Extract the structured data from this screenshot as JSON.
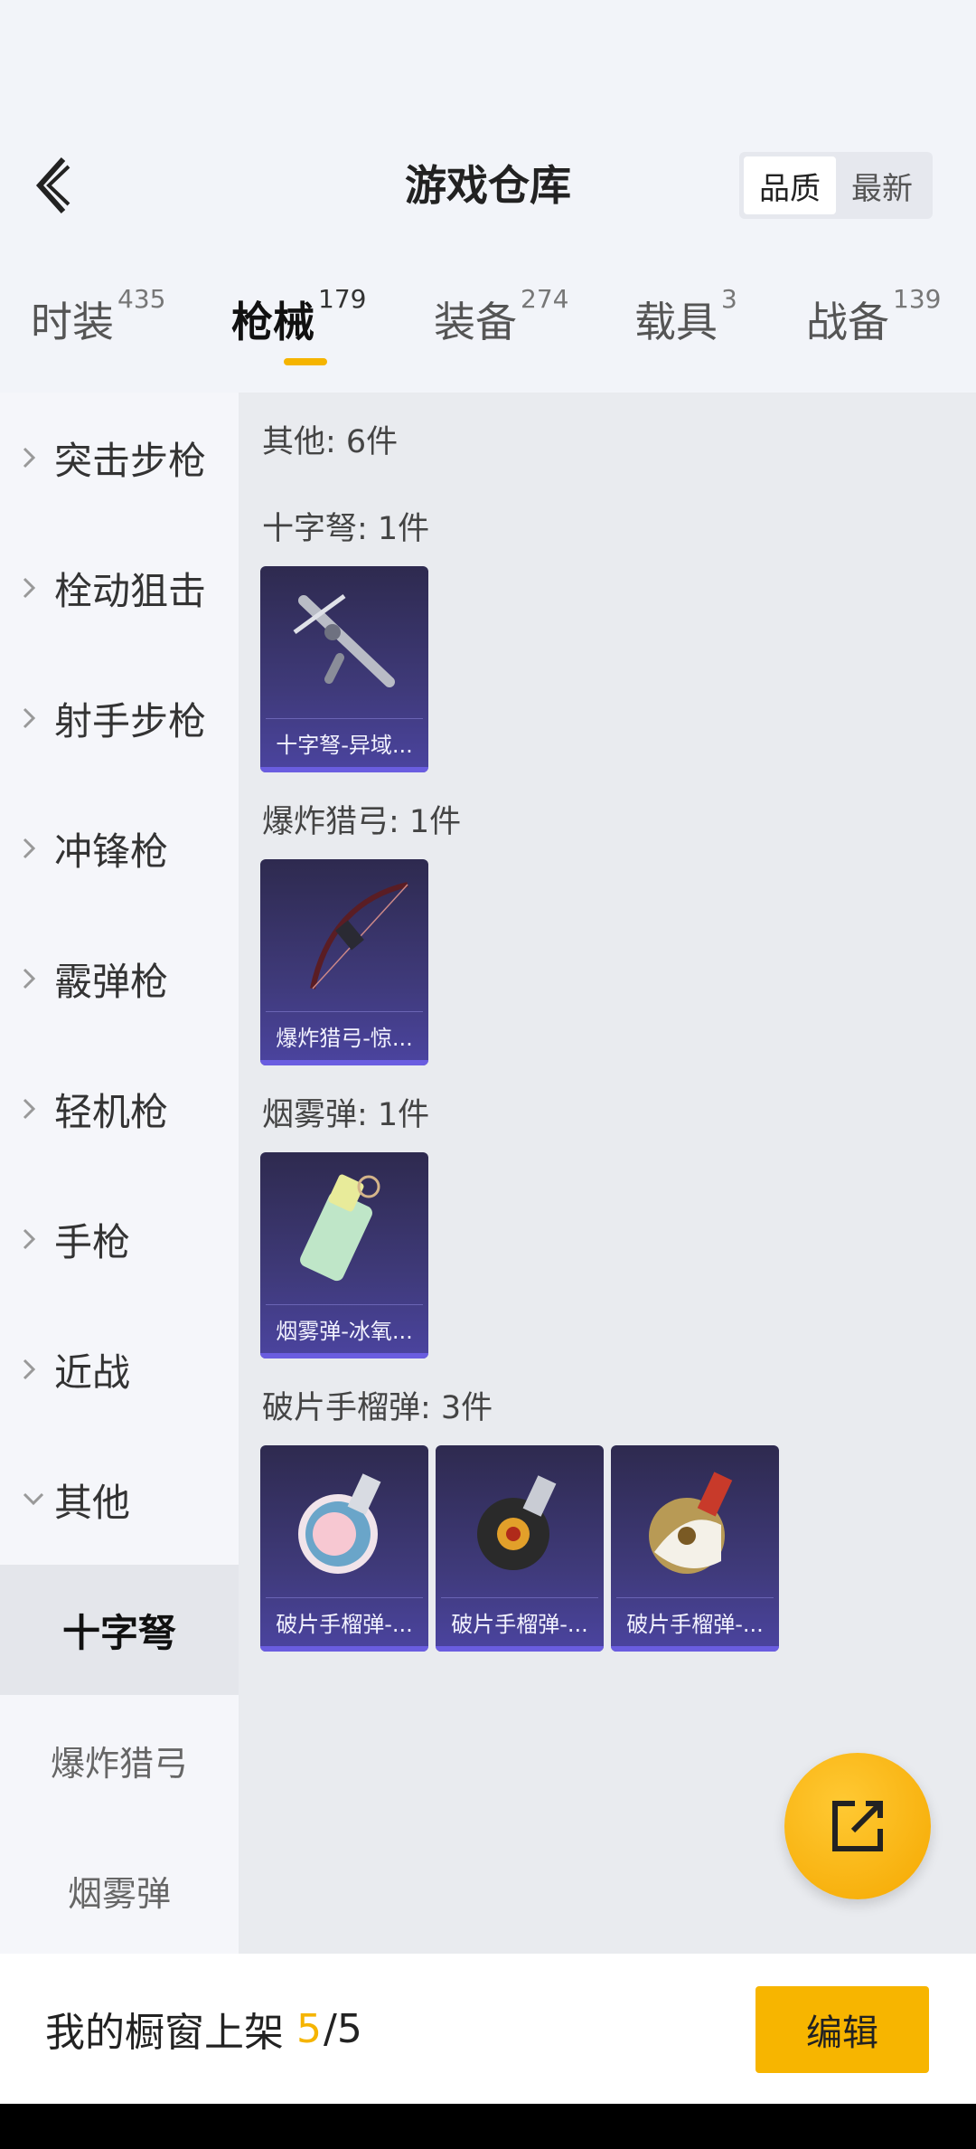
{
  "header": {
    "title": "游戏仓库",
    "sort_options": [
      "品质",
      "最新"
    ],
    "sort_selected": "品质"
  },
  "tabs": [
    {
      "label": "时装",
      "count": "435"
    },
    {
      "label": "枪械",
      "count": "179",
      "active": true
    },
    {
      "label": "装备",
      "count": "274"
    },
    {
      "label": "载具",
      "count": "3"
    },
    {
      "label": "战备",
      "count": "139"
    }
  ],
  "sidebar": {
    "categories": [
      "突击步枪",
      "栓动狙击",
      "射手步枪",
      "冲锋枪",
      "霰弹枪",
      "轻机枪",
      "手枪",
      "近战",
      "其他"
    ],
    "expanded": "其他",
    "subcategories": [
      "十字弩",
      "爆炸猎弓",
      "烟雾弹"
    ],
    "selected_sub": "十字弩"
  },
  "content": {
    "summary": "其他: 6件",
    "sections": [
      {
        "heading": "十字弩: 1件",
        "items": [
          "十字弩-异域..."
        ]
      },
      {
        "heading": "爆炸猎弓: 1件",
        "items": [
          "爆炸猎弓-惊..."
        ]
      },
      {
        "heading": "烟雾弹: 1件",
        "items": [
          "烟雾弹-冰氧..."
        ]
      },
      {
        "heading": "破片手榴弹: 3件",
        "items": [
          "破片手榴弹-...",
          "破片手榴弹-...",
          "破片手榴弹-..."
        ]
      }
    ]
  },
  "bottom_bar": {
    "label": "我的橱窗上架",
    "count": "5",
    "total": "/5",
    "edit_label": "编辑"
  },
  "colors": {
    "accent": "#f5b400",
    "card_bg": "#3f3a7a"
  },
  "icons": [
    "back-arrow-icon",
    "chevron-right-icon",
    "chevron-down-icon",
    "share-icon"
  ]
}
